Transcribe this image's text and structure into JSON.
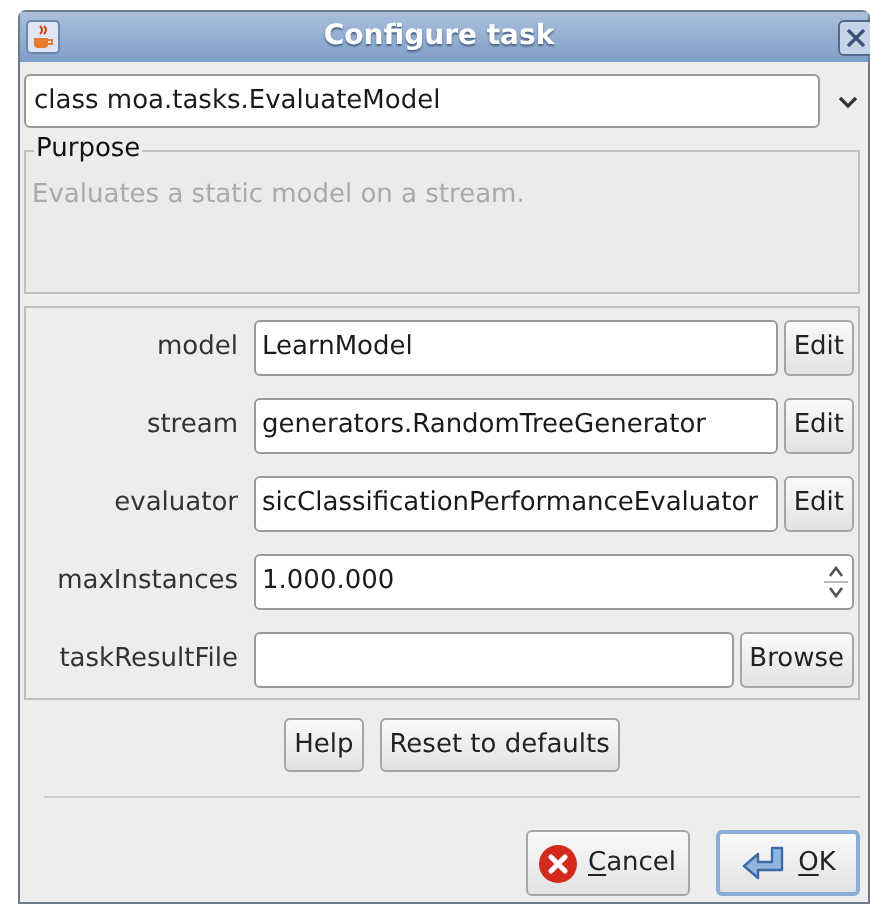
{
  "window": {
    "title": "Configure task"
  },
  "task_selector": {
    "value": "class moa.tasks.EvaluateModel"
  },
  "purpose": {
    "title": "Purpose",
    "text": "Evaluates a static model on a stream."
  },
  "options": [
    {
      "kind": "edit",
      "label": "model",
      "value": "LearnModel",
      "button": "Edit"
    },
    {
      "kind": "edit",
      "label": "stream",
      "value": "generators.RandomTreeGenerator",
      "button": "Edit"
    },
    {
      "kind": "edit",
      "label": "evaluator",
      "value": "sicClassificationPerformanceEvaluator",
      "button": "Edit"
    },
    {
      "kind": "spinner",
      "label": "maxInstances",
      "value": "1.000.000"
    },
    {
      "kind": "file",
      "label": "taskResultFile",
      "button": "Browse"
    }
  ],
  "panel_buttons": [
    "Help",
    "Reset to defaults"
  ],
  "dialog_buttons": [
    {
      "kind": "cancel",
      "label": "Cancel",
      "default": false
    },
    {
      "kind": "ok",
      "label": "OK",
      "default": true
    }
  ]
}
